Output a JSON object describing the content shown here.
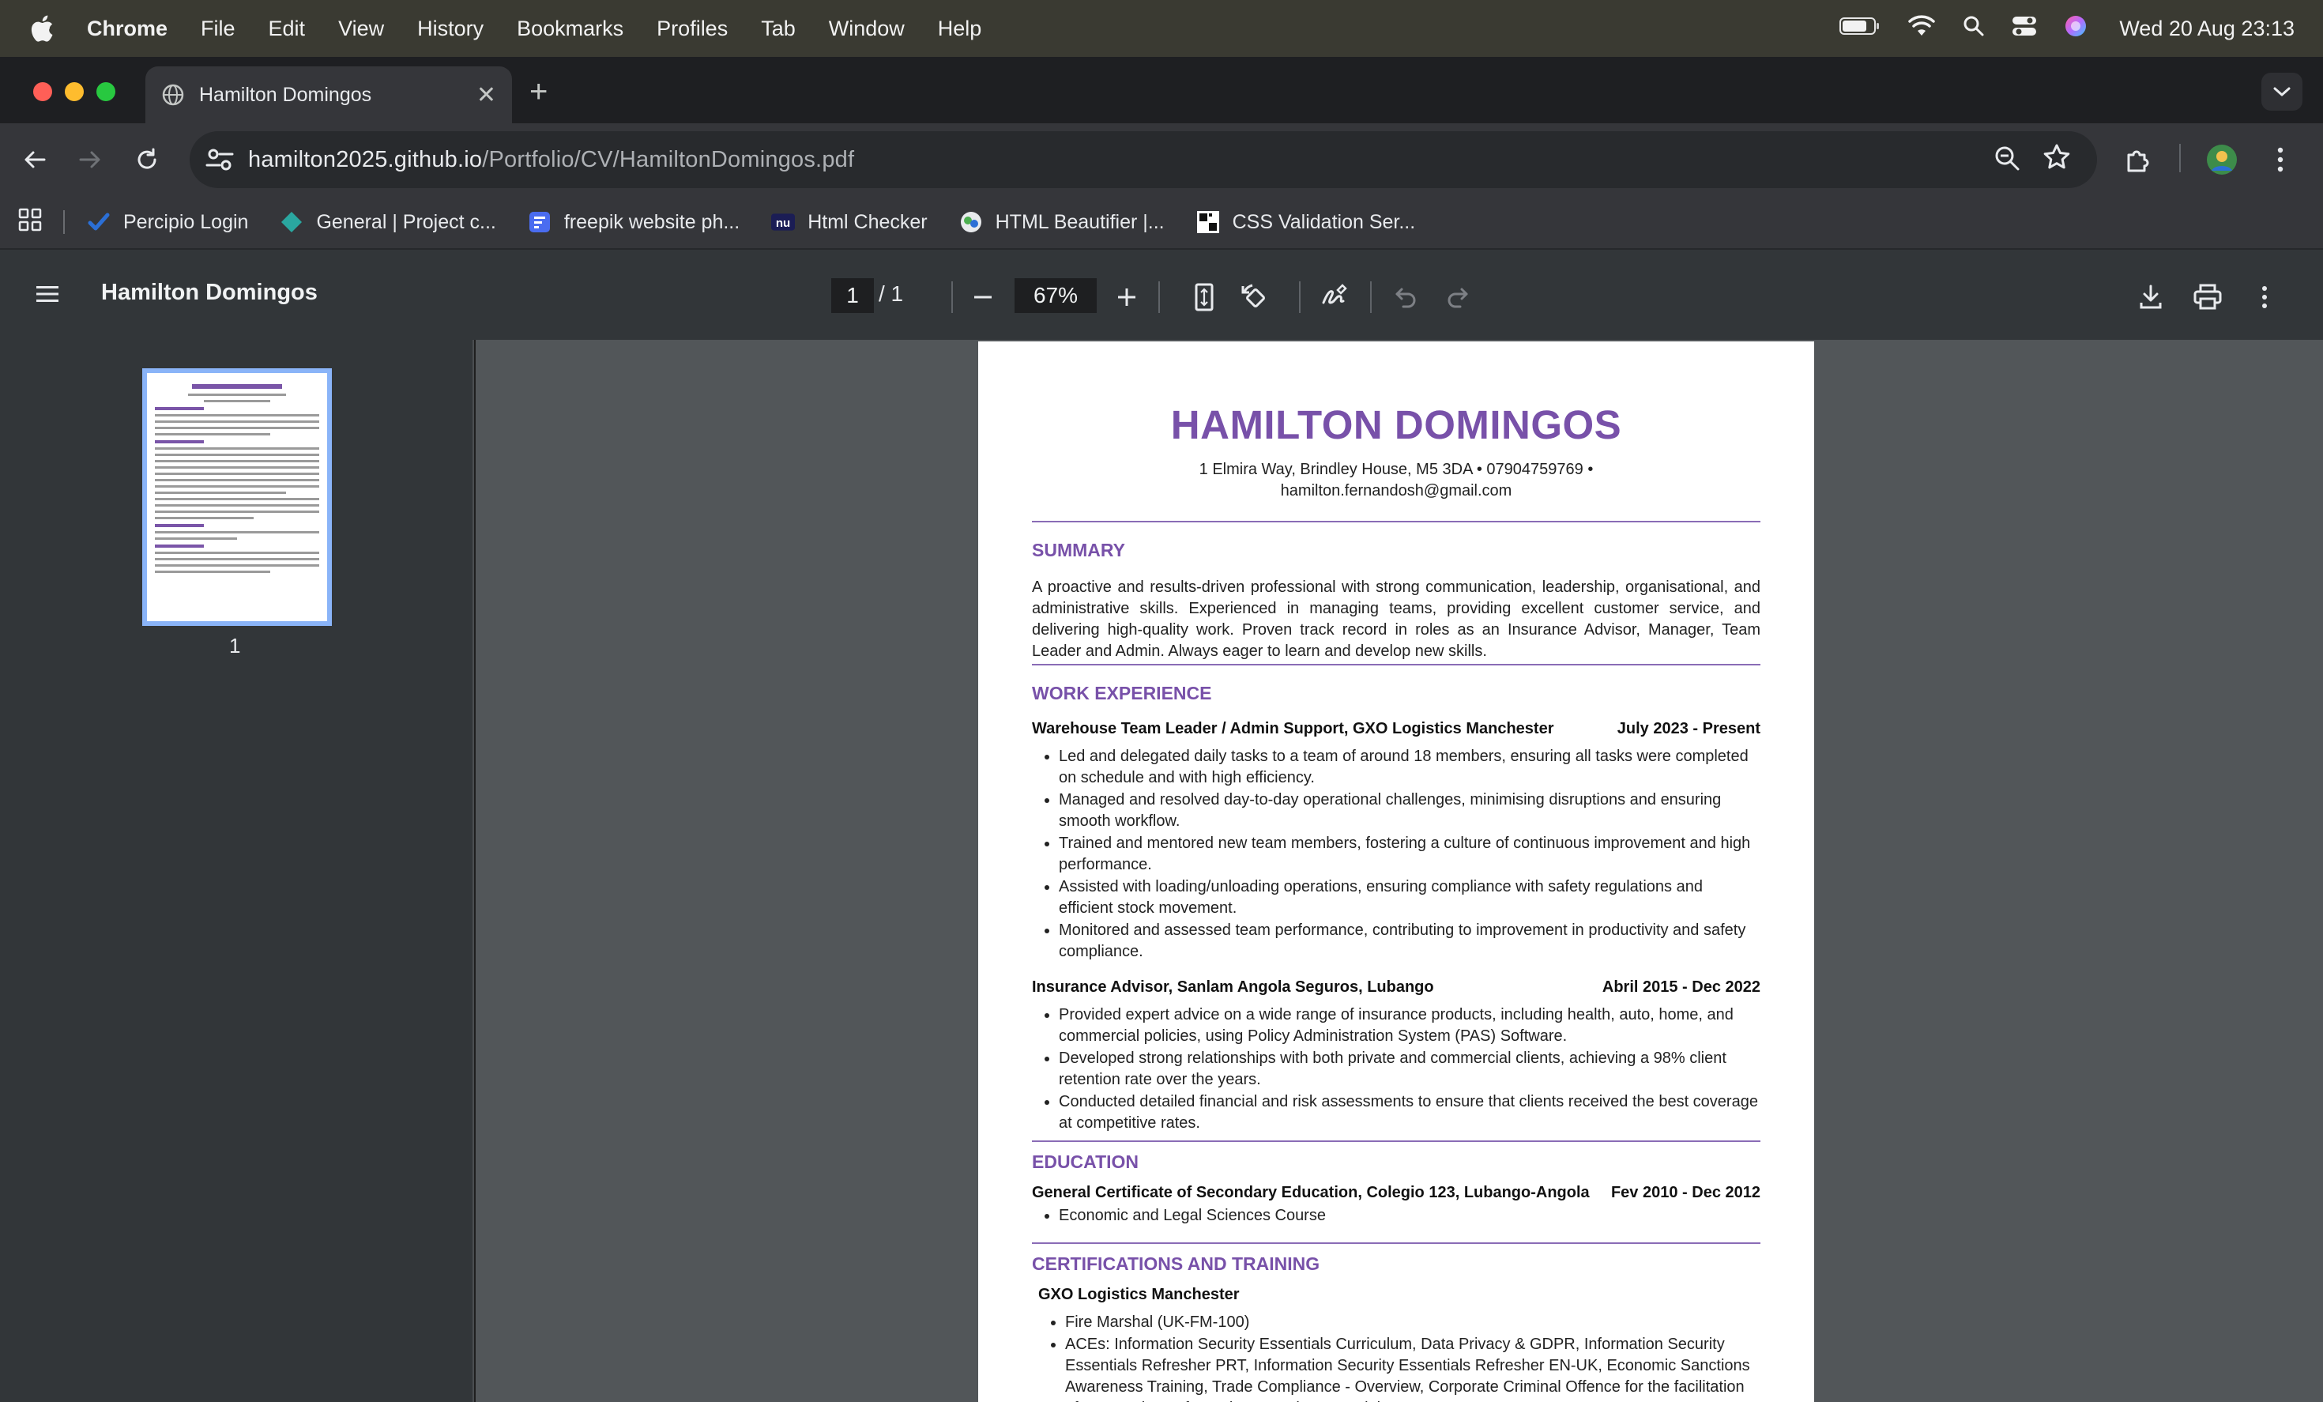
{
  "menubar": {
    "app": "Chrome",
    "items": [
      "File",
      "Edit",
      "View",
      "History",
      "Bookmarks",
      "Profiles",
      "Tab",
      "Window",
      "Help"
    ],
    "clock": "Wed 20 Aug  23:13"
  },
  "tab": {
    "title": "Hamilton Domingos"
  },
  "omnibox": {
    "host": "hamilton2025.github.io",
    "path": "/Portfolio/CV/HamiltonDomingos.pdf"
  },
  "bookmarks": [
    {
      "label": "Percipio Login",
      "icon": "percipio-check-icon",
      "color": "#2b6fd6"
    },
    {
      "label": "General | Project c...",
      "icon": "diamond-icon",
      "color": "#2aa7a0"
    },
    {
      "label": "freepik website ph...",
      "icon": "forms-icon",
      "color": "#4a6cf0"
    },
    {
      "label": "Html Checker",
      "icon": "nu-icon",
      "color": "#2a2f86"
    },
    {
      "label": "HTML Beautifier |...",
      "icon": "beautifier-icon",
      "color": "#4caf50"
    },
    {
      "label": "CSS Validation Ser...",
      "icon": "w3c-icon",
      "color": "#111111"
    }
  ],
  "pdf": {
    "title": "Hamilton Domingos",
    "page_current": "1",
    "page_total": "/ 1",
    "zoom": "67%",
    "thumb_label": "1"
  },
  "cv": {
    "name": "HAMILTON DOMINGOS",
    "contact1": "1 Elmira Way, Brindley House, M5 3DA • 07904759769 •",
    "contact2": "hamilton.fernandosh@gmail.com",
    "summary_title": "SUMMARY",
    "summary": "A proactive and results-driven professional with strong communication, leadership, organisational, and administrative skills. Experienced in managing teams, providing excellent customer service, and delivering high-quality work. Proven track record in roles as an Insurance Advisor, Manager, Team Leader and Admin. Always eager to learn and develop new skills.",
    "work_title": "WORK EXPERIENCE",
    "jobs": [
      {
        "role": "Warehouse Team Leader / Admin Support, GXO Logistics Manchester",
        "dates": "July 2023 - Present",
        "bullets": [
          "Led and delegated daily tasks to a team of around 18 members, ensuring all tasks were completed on schedule and with high efficiency.",
          "Managed and resolved day-to-day operational challenges, minimising disruptions and ensuring smooth workflow.",
          "Trained and mentored new team members, fostering a culture of continuous improvement and high performance.",
          "Assisted with loading/unloading operations, ensuring compliance with safety regulations and efficient stock movement.",
          "Monitored and assessed team performance, contributing to improvement in productivity and safety compliance."
        ]
      },
      {
        "role": "Insurance Advisor, Sanlam Angola Seguros, Lubango",
        "dates": "Abril 2015 - Dec 2022",
        "bullets": [
          "Provided expert advice on a wide range of insurance products, including health, auto, home, and commercial policies, using Policy Administration System (PAS) Software.",
          "Developed strong relationships with both private and commercial clients, achieving a 98% client retention rate over the years.",
          "Conducted detailed financial and risk assessments to ensure that clients received the best coverage at competitive rates."
        ]
      }
    ],
    "education_title": "EDUCATION",
    "education": {
      "degree": "General Certificate of Secondary Education, Colegio 123, Lubango-Angola",
      "dates": "Fev 2010 - Dec 2012",
      "bullets": [
        "Economic and Legal Sciences Course"
      ]
    },
    "cert_title": "CERTIFICATIONS AND TRAINING",
    "cert_org": "GXO Logistics Manchester",
    "cert_bullets": [
      "Fire Marshal (UK-FM-100)",
      "ACEs: Information Security Essentials Curriculum, Data Privacy & GDPR, Information Security Essentials Refresher PRT, Information Security Essentials Refresher EN-UK, Economic Sanctions Awareness Training, Trade Compliance - Overview, Corporate Criminal Offence for the facilitation of tax evasion, Information Security Essentials EN UK ."
    ]
  }
}
